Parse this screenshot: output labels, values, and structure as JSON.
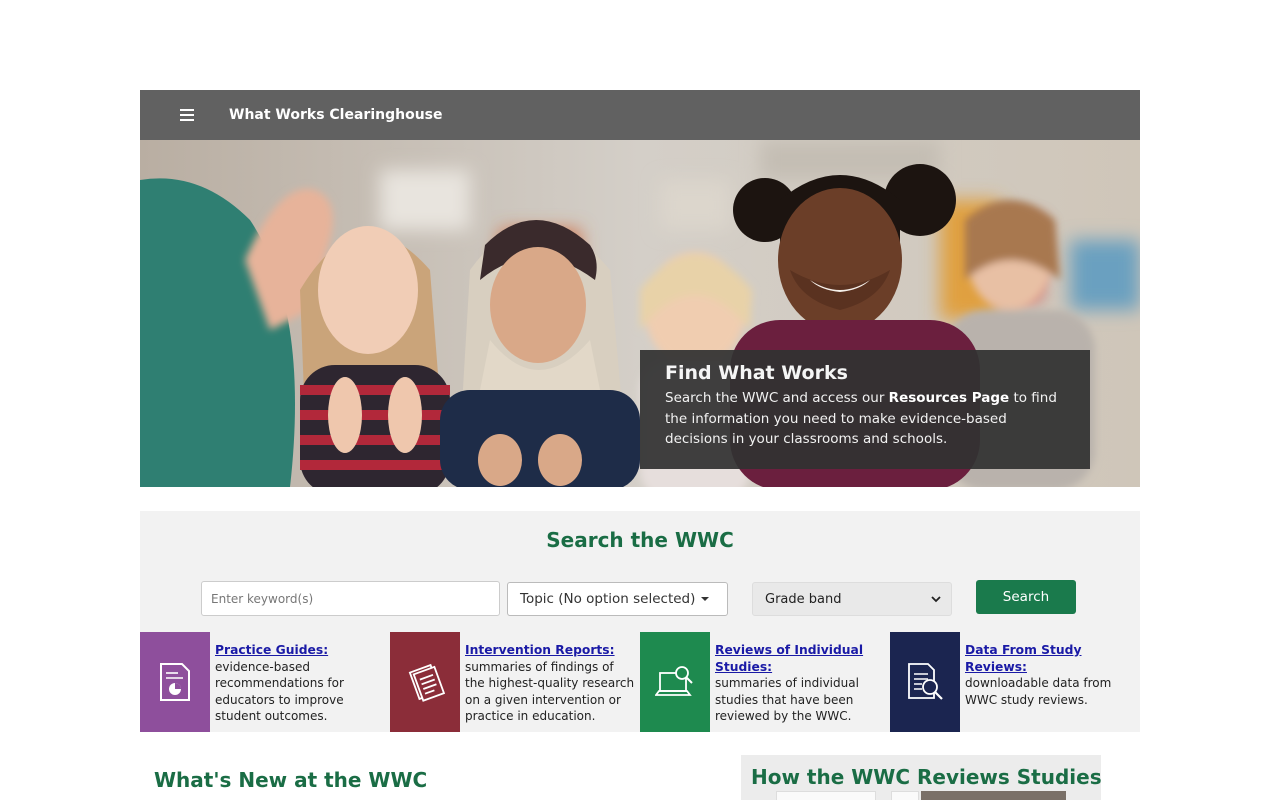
{
  "header": {
    "menu_icon": "hamburger-menu-icon",
    "title": "What Works Clearinghouse"
  },
  "hero": {
    "image": "classroom-children-photo",
    "card_title": "Find What Works",
    "card_text_before": "Search the WWC and access our ",
    "card_text_bold": "Resources Page",
    "card_text_after": " to find the information you need to make evidence-based decisions in your classrooms and schools."
  },
  "search": {
    "title": "Search the WWC",
    "keyword_placeholder": "Enter keyword(s)",
    "keyword_value": "",
    "topic_label": "Topic (No option selected)",
    "grade_label": "Grade band",
    "search_button": "Search"
  },
  "tiles": [
    {
      "title": "Practice Guides:",
      "text": "evidence-based recommendations for educators to improve student outcomes.",
      "color": "#8e4f9c",
      "icon": "document-chart-icon"
    },
    {
      "title": "Intervention Reports:",
      "text": "summaries of findings of the highest-quality research on a given intervention or practice in education.",
      "color": "#8b2d39",
      "icon": "stacked-papers-icon"
    },
    {
      "title": "Reviews of Individual Studies:",
      "text": "summaries of individual studies that have been reviewed by the WWC.",
      "color": "#1e8a4f",
      "icon": "laptop-magnifier-icon"
    },
    {
      "title": "Data From Study Reviews:",
      "text": "downloadable data from WWC study reviews.",
      "color": "#1b2550",
      "icon": "document-magnifier-icon"
    }
  ],
  "bottom": {
    "whats_new_title": "What's New at the WWC",
    "how_title": "How the WWC Reviews Studies"
  }
}
